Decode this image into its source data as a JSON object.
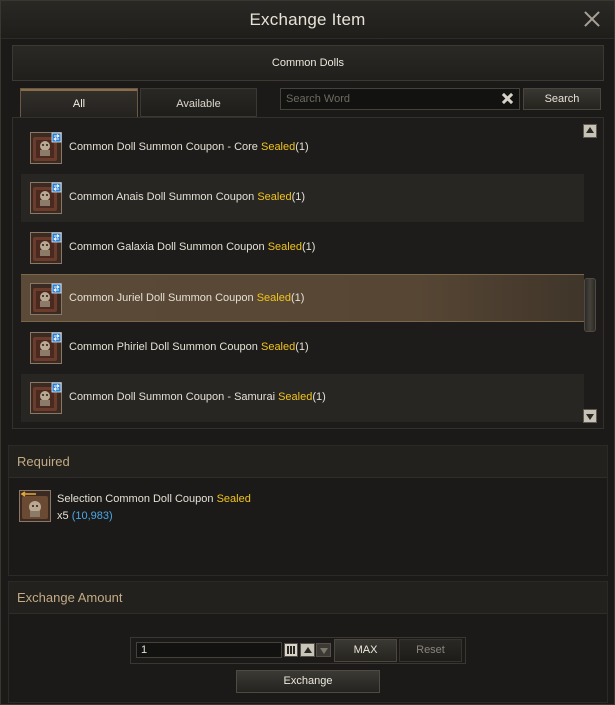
{
  "window": {
    "title": "Exchange Item"
  },
  "category": {
    "label": "Common Dolls"
  },
  "tabs": [
    {
      "label": "All",
      "active": true
    },
    {
      "label": "Available",
      "active": false
    }
  ],
  "search": {
    "placeholder": "Search Word",
    "value": "",
    "button_label": "Search"
  },
  "items": [
    {
      "name": "Common Doll Summon Coupon - Core",
      "sealed": "Sealed",
      "count": "(1)",
      "icon": "doll-coupon-icon"
    },
    {
      "name": "Common Anais Doll Summon Coupon",
      "sealed": "Sealed",
      "count": "(1)",
      "icon": "doll-coupon-icon"
    },
    {
      "name": "Common Galaxia Doll Summon Coupon",
      "sealed": "Sealed",
      "count": "(1)",
      "icon": "doll-coupon-icon"
    },
    {
      "name": "Common Juriel Doll Summon Coupon",
      "sealed": "Sealed",
      "count": "(1)",
      "icon": "doll-coupon-icon",
      "selected": true
    },
    {
      "name": "Common Phiriel Doll Summon Coupon",
      "sealed": "Sealed",
      "count": "(1)",
      "icon": "doll-coupon-icon"
    },
    {
      "name": "Common Doll Summon Coupon - Samurai",
      "sealed": "Sealed",
      "count": "(1)",
      "icon": "doll-coupon-icon"
    }
  ],
  "required": {
    "header": "Required",
    "item_name": "Selection Common Doll Coupon",
    "sealed": "Sealed",
    "qty": "x5",
    "owned": "(10,983)",
    "icon": "selection-coupon-icon"
  },
  "amount": {
    "header": "Exchange Amount",
    "value": "1",
    "max_label": "MAX",
    "reset_label": "Reset",
    "exchange_label": "Exchange"
  },
  "colors": {
    "sealed": "#f2c41b",
    "owned": "#4aa8e8",
    "section_header": "#c3ab84",
    "selected_row": "#574634"
  }
}
